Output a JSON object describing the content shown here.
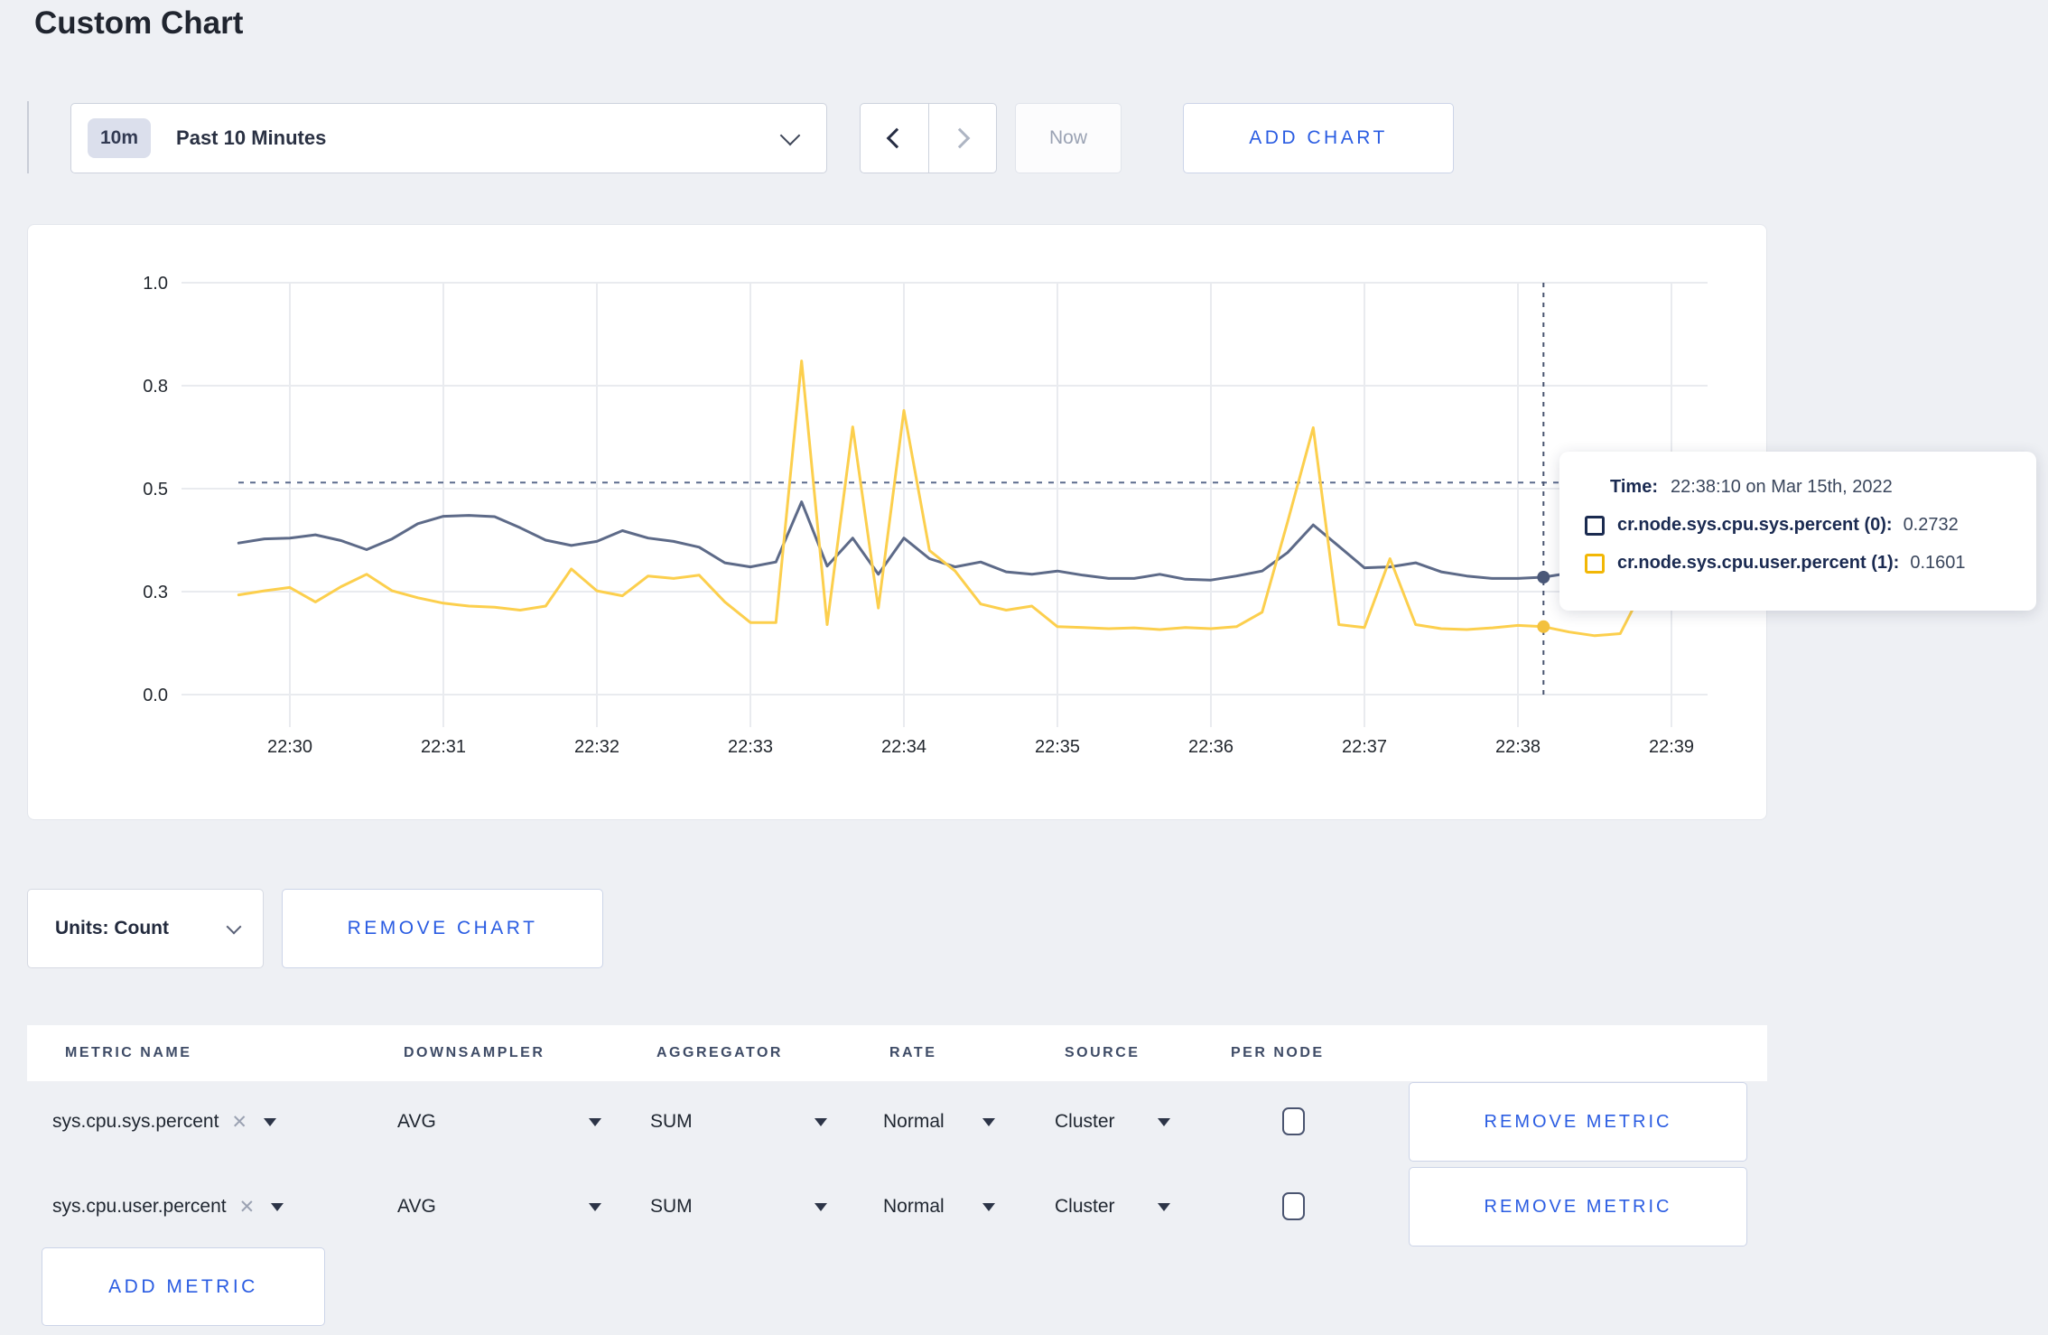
{
  "page": {
    "title": "Custom Chart",
    "background": "#eef0f4",
    "accent_blue": "#2a5ce2"
  },
  "toolbar": {
    "time_window_badge": "10m",
    "time_window_label": "Past 10 Minutes",
    "now_label": "Now",
    "add_chart_label": "ADD CHART"
  },
  "icons": {
    "time_selector": "chevron-down",
    "prev": "chevron-left",
    "next": "chevron-right",
    "units": "chevron-down",
    "metric_remove": "x",
    "select_caret": "caret-down"
  },
  "chart_data": {
    "type": "line",
    "title": "",
    "grid": true,
    "x_axis": {
      "tick_labels": [
        "22:30",
        "22:31",
        "22:32",
        "22:33",
        "22:34",
        "22:35",
        "22:36",
        "22:37",
        "22:38",
        "22:39"
      ],
      "tick_interval_seconds": 60,
      "first_tick_seconds": 20
    },
    "y_axis": {
      "range": [
        0,
        1
      ],
      "tick_values": [
        0,
        0.25,
        0.5,
        0.75,
        1.0
      ],
      "tick_labels": [
        "0.0",
        "0.3",
        "0.5",
        "0.8",
        "1.0"
      ]
    },
    "sample_step_seconds": 10,
    "threshold_value": 0.515,
    "series": [
      {
        "name": "cr.node.sys.cpu.sys.percent",
        "color": "#5d6a88",
        "values": [
          0.368,
          0.378,
          0.38,
          0.388,
          0.374,
          0.352,
          0.378,
          0.415,
          0.433,
          0.435,
          0.432,
          0.405,
          0.375,
          0.362,
          0.372,
          0.398,
          0.38,
          0.372,
          0.358,
          0.32,
          0.31,
          0.322,
          0.468,
          0.312,
          0.38,
          0.292,
          0.38,
          0.33,
          0.31,
          0.322,
          0.298,
          0.292,
          0.3,
          0.29,
          0.282,
          0.282,
          0.292,
          0.28,
          0.278,
          0.288,
          0.3,
          0.345,
          0.412,
          0.36,
          0.308,
          0.31,
          0.32,
          0.298,
          0.288,
          0.282,
          0.282,
          0.285,
          0.295,
          0.292,
          0.288,
          0.292,
          0.288,
          0.29
        ]
      },
      {
        "name": "cr.node.sys.cpu.user.percent",
        "color": "#fccf4d",
        "values": [
          0.242,
          0.252,
          0.26,
          0.225,
          0.262,
          0.292,
          0.252,
          0.235,
          0.222,
          0.215,
          0.212,
          0.205,
          0.215,
          0.305,
          0.252,
          0.24,
          0.288,
          0.282,
          0.29,
          0.225,
          0.175,
          0.175,
          0.81,
          0.17,
          0.65,
          0.21,
          0.69,
          0.35,
          0.3,
          0.22,
          0.205,
          0.215,
          0.165,
          0.163,
          0.16,
          0.162,
          0.158,
          0.163,
          0.16,
          0.165,
          0.2,
          0.42,
          0.648,
          0.17,
          0.163,
          0.33,
          0.17,
          0.16,
          0.158,
          0.162,
          0.168,
          0.165,
          0.152,
          0.143,
          0.148,
          0.27,
          0.225,
          0.282
        ]
      }
    ],
    "crosshair": {
      "t_seconds": 510,
      "points": [
        {
          "series": "cr.node.sys.cpu.sys.percent",
          "value": 0.285,
          "color": "#4a5878"
        },
        {
          "series": "cr.node.sys.cpu.user.percent",
          "value": 0.165,
          "color": "#f3c13d"
        }
      ]
    }
  },
  "tooltip": {
    "time_label": "Time:",
    "time_value": "22:38:10 on Mar 15th, 2022",
    "rows": [
      {
        "label": "cr.node.sys.cpu.sys.percent (0):",
        "value": "0.2732",
        "color": "#1b2b50"
      },
      {
        "label": "cr.node.sys.cpu.user.percent (1):",
        "value": "0.1601",
        "color": "#f2b705"
      }
    ]
  },
  "chart_controls": {
    "units_label": "Units: Count",
    "remove_chart_label": "REMOVE CHART"
  },
  "metrics_table": {
    "headers": [
      "METRIC NAME",
      "DOWNSAMPLER",
      "AGGREGATOR",
      "RATE",
      "SOURCE",
      "PER NODE"
    ],
    "rows": [
      {
        "metric": "sys.cpu.sys.percent",
        "remove_icon": "✕",
        "downsampler": "AVG",
        "aggregator": "SUM",
        "rate": "Normal",
        "source": "Cluster",
        "per_node_checked": false,
        "remove_label": "REMOVE METRIC"
      },
      {
        "metric": "sys.cpu.user.percent",
        "remove_icon": "✕",
        "downsampler": "AVG",
        "aggregator": "SUM",
        "rate": "Normal",
        "source": "Cluster",
        "per_node_checked": false,
        "remove_label": "REMOVE METRIC"
      }
    ],
    "add_metric_label": "ADD METRIC"
  }
}
